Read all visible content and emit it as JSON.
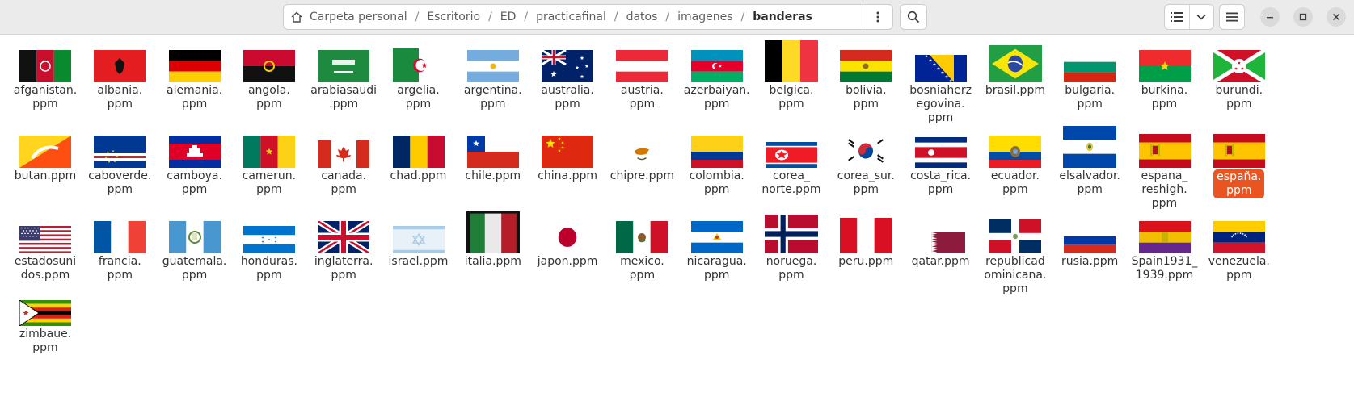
{
  "header": {
    "path": [
      "Carpeta personal",
      "Escritorio",
      "ED",
      "practicafinal",
      "datos",
      "imagenes",
      "banderas"
    ],
    "icons": {
      "home": "home-icon",
      "path_menu": "vertical-dots-icon",
      "search": "search-icon",
      "list_view": "list-view-icon",
      "view_options": "chevron-down-icon",
      "main_menu": "hamburger-menu-icon",
      "minimize": "minimize-icon",
      "maximize": "maximize-icon",
      "close": "close-icon"
    }
  },
  "files": [
    {
      "name": "afganistan.\nppm",
      "flag": "afganistan"
    },
    {
      "name": "albania.\nppm",
      "flag": "albania"
    },
    {
      "name": "alemania.\nppm",
      "flag": "alemania"
    },
    {
      "name": "angola.\nppm",
      "flag": "angola"
    },
    {
      "name": "arabiasaudi\n.ppm",
      "flag": "arabiasaudi"
    },
    {
      "name": "argelia.\nppm",
      "flag": "argelia"
    },
    {
      "name": "argentina.\nppm",
      "flag": "argentina"
    },
    {
      "name": "australia.\nppm",
      "flag": "australia"
    },
    {
      "name": "austria.\nppm",
      "flag": "austria"
    },
    {
      "name": "azerbaiyan.\nppm",
      "flag": "azerbaiyan"
    },
    {
      "name": "belgica.\nppm",
      "flag": "belgica"
    },
    {
      "name": "bolivia.\nppm",
      "flag": "bolivia"
    },
    {
      "name": "bosniaherz\negovina.\nppm",
      "flag": "bosnia"
    },
    {
      "name": "brasil.ppm",
      "flag": "brasil"
    },
    {
      "name": "bulgaria.\nppm",
      "flag": "bulgaria"
    },
    {
      "name": "burkina.\nppm",
      "flag": "burkina"
    },
    {
      "name": "burundi.\nppm",
      "flag": "burundi"
    },
    {
      "name": "butan.ppm",
      "flag": "butan"
    },
    {
      "name": "caboverde.\nppm",
      "flag": "caboverde"
    },
    {
      "name": "camboya.\nppm",
      "flag": "camboya"
    },
    {
      "name": "camerun.\nppm",
      "flag": "camerun"
    },
    {
      "name": "canada.\nppm",
      "flag": "canada"
    },
    {
      "name": "chad.ppm",
      "flag": "chad"
    },
    {
      "name": "chile.ppm",
      "flag": "chile"
    },
    {
      "name": "china.ppm",
      "flag": "china"
    },
    {
      "name": "chipre.ppm",
      "flag": "chipre"
    },
    {
      "name": "colombia.\nppm",
      "flag": "colombia"
    },
    {
      "name": "corea_\nnorte.ppm",
      "flag": "coreanorte"
    },
    {
      "name": "corea_sur.\nppm",
      "flag": "coreasur"
    },
    {
      "name": "costa_rica.\nppm",
      "flag": "costarica"
    },
    {
      "name": "ecuador.\nppm",
      "flag": "ecuador"
    },
    {
      "name": "elsalvador.\nppm",
      "flag": "elsalvador"
    },
    {
      "name": "espana_\nreshigh.\nppm",
      "flag": "espana"
    },
    {
      "name": "españa.\nppm",
      "flag": "espana",
      "selected": true
    },
    {
      "name": "estadosuni\ndos.ppm",
      "flag": "usa"
    },
    {
      "name": "francia.\nppm",
      "flag": "francia"
    },
    {
      "name": "guatemala.\nppm",
      "flag": "guatemala"
    },
    {
      "name": "honduras.\nppm",
      "flag": "honduras"
    },
    {
      "name": "inglaterra.\nppm",
      "flag": "uk"
    },
    {
      "name": "israel.ppm",
      "flag": "israel"
    },
    {
      "name": "italia.ppm",
      "flag": "italia"
    },
    {
      "name": "japon.ppm",
      "flag": "japon"
    },
    {
      "name": "mexico.\nppm",
      "flag": "mexico"
    },
    {
      "name": "nicaragua.\nppm",
      "flag": "nicaragua"
    },
    {
      "name": "noruega.\nppm",
      "flag": "noruega"
    },
    {
      "name": "peru.ppm",
      "flag": "peru"
    },
    {
      "name": "qatar.ppm",
      "flag": "qatar"
    },
    {
      "name": "republicad\nominicana.\nppm",
      "flag": "dominicana"
    },
    {
      "name": "rusia.ppm",
      "flag": "rusia"
    },
    {
      "name": "Spain1931_\n1939.ppm",
      "flag": "spain1931"
    },
    {
      "name": "venezuela.\nppm",
      "flag": "venezuela"
    },
    {
      "name": "zimbaue.\nppm",
      "flag": "zimbabue"
    }
  ]
}
